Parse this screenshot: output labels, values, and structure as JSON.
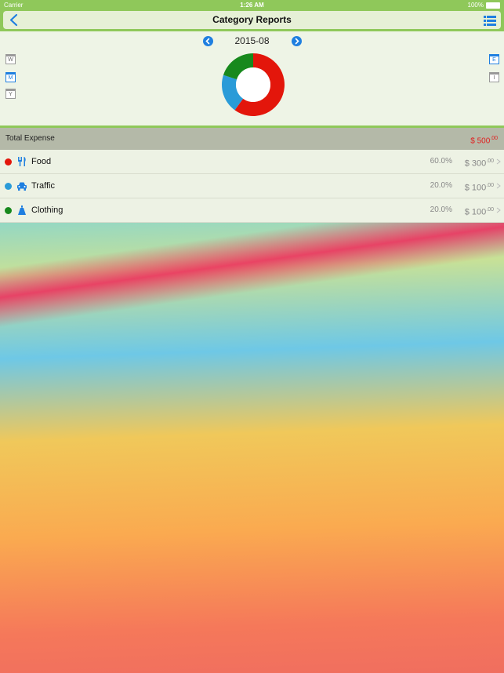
{
  "status_bar": {
    "carrier": "Carrier",
    "time": "1:26 AM",
    "battery": "100%"
  },
  "nav": {
    "title": "Category Reports",
    "back_icon": "chevron-left-icon",
    "menu_icon": "list-icon"
  },
  "period": {
    "label": "2015-08",
    "prev_icon": "chevron-left-circle-icon",
    "next_icon": "chevron-right-circle-icon"
  },
  "left_toggles": [
    {
      "letter": "W",
      "active": false
    },
    {
      "letter": "M",
      "active": true
    },
    {
      "letter": "Y",
      "active": false
    }
  ],
  "right_toggles": [
    {
      "letter": "E",
      "active": true
    },
    {
      "letter": "I",
      "active": false
    }
  ],
  "chart_data": {
    "type": "pie",
    "donut": true,
    "slices": [
      {
        "label": "Food",
        "value": 60.0,
        "color": "#e3160b"
      },
      {
        "label": "Traffic",
        "value": 20.0,
        "color": "#2a9bd8"
      },
      {
        "label": "Clothing",
        "value": 20.0,
        "color": "#17891d"
      }
    ]
  },
  "total": {
    "label": "Total Expense",
    "currency": "$",
    "amount": "500",
    "cents": ".00",
    "color": "#e02020"
  },
  "categories": [
    {
      "name": "Food",
      "icon": "fork-knife-icon",
      "dot_color": "#e3160b",
      "percent": "60.0%",
      "currency": "$",
      "amount": "300",
      "cents": ".00"
    },
    {
      "name": "Traffic",
      "icon": "car-icon",
      "dot_color": "#2a9bd8",
      "percent": "20.0%",
      "currency": "$",
      "amount": "100",
      "cents": ".00"
    },
    {
      "name": "Clothing",
      "icon": "clothing-icon",
      "dot_color": "#17891d",
      "percent": "20.0%",
      "currency": "$",
      "amount": "100",
      "cents": ".00"
    }
  ],
  "colors": {
    "accent": "#1f7fe0",
    "bar_green": "#8fc85a"
  }
}
